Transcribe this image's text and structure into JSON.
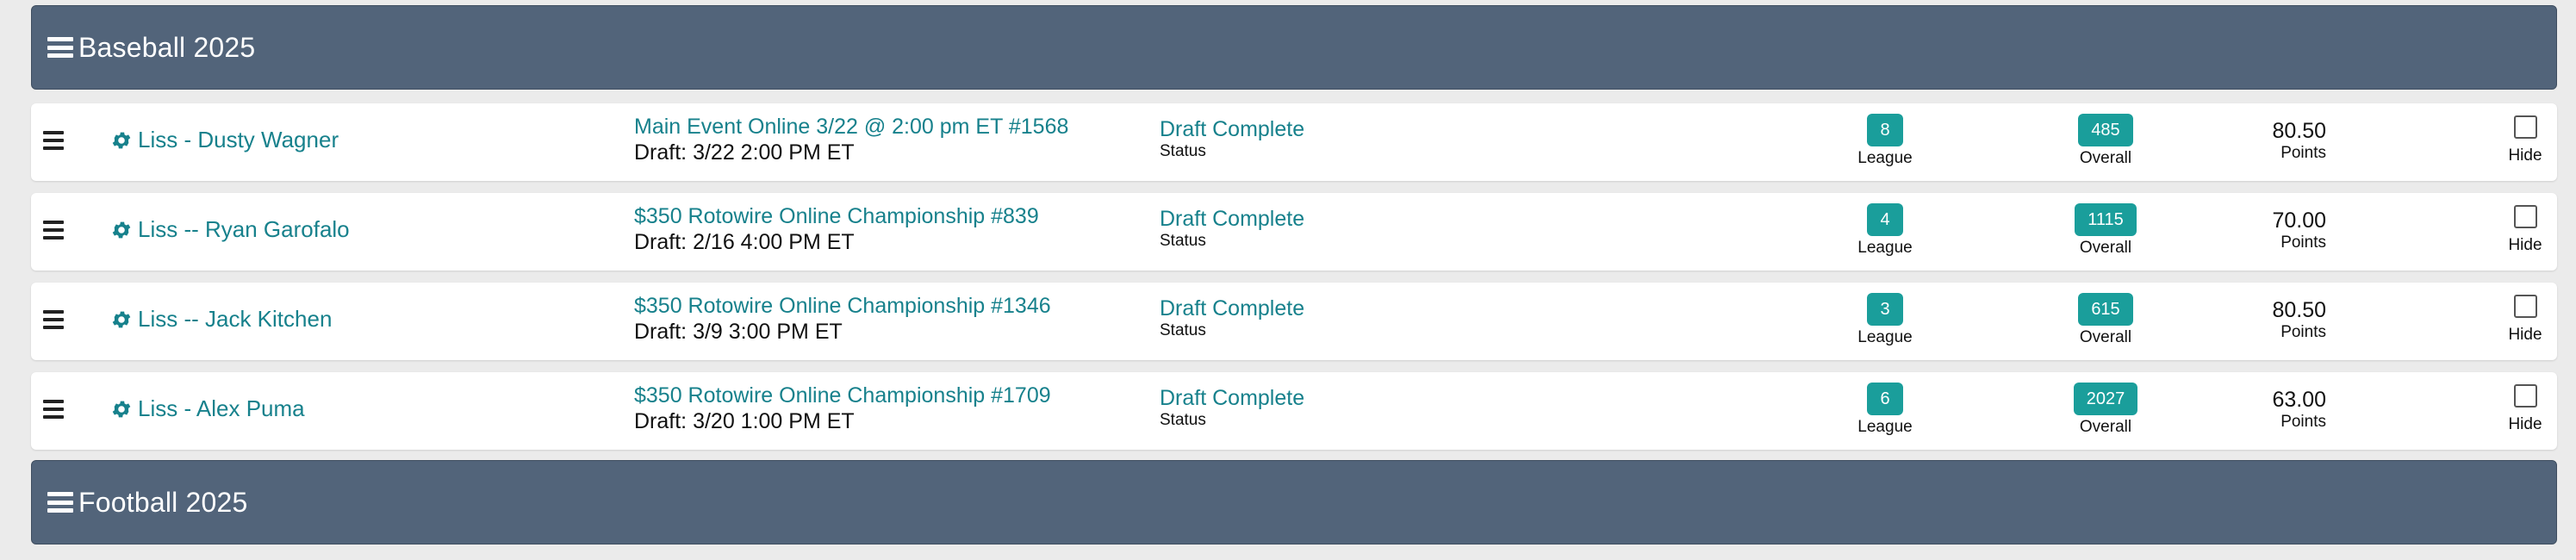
{
  "sections": [
    {
      "title": "Baseball 2025"
    },
    {
      "title": "Football 2025"
    }
  ],
  "entries": [
    {
      "name": "Liss - Dusty Wagner",
      "contest": "Main Event Online 3/22 @ 2:00 pm ET #1568",
      "draft_time": "Draft: 3/22 2:00 PM ET",
      "status": "Draft Complete",
      "status_label": "Status",
      "league_rank": "8",
      "league_label": "League",
      "overall_rank": "485",
      "overall_label": "Overall",
      "points": "80.50",
      "points_label": "Points",
      "hide_label": "Hide"
    },
    {
      "name": "Liss -- Ryan Garofalo",
      "contest": "$350 Rotowire Online Championship #839",
      "draft_time": "Draft: 2/16 4:00 PM ET",
      "status": "Draft Complete",
      "status_label": "Status",
      "league_rank": "4",
      "league_label": "League",
      "overall_rank": "1115",
      "overall_label": "Overall",
      "points": "70.00",
      "points_label": "Points",
      "hide_label": "Hide"
    },
    {
      "name": "Liss -- Jack Kitchen",
      "contest": "$350 Rotowire Online Championship #1346",
      "draft_time": "Draft: 3/9 3:00 PM ET",
      "status": "Draft Complete",
      "status_label": "Status",
      "league_rank": "3",
      "league_label": "League",
      "overall_rank": "615",
      "overall_label": "Overall",
      "points": "80.50",
      "points_label": "Points",
      "hide_label": "Hide"
    },
    {
      "name": "Liss - Alex Puma",
      "contest": "$350 Rotowire Online Championship #1709",
      "draft_time": "Draft: 3/20 1:00 PM ET",
      "status": "Draft Complete",
      "status_label": "Status",
      "league_rank": "6",
      "league_label": "League",
      "overall_rank": "2027",
      "overall_label": "Overall",
      "points": "63.00",
      "points_label": "Points",
      "hide_label": "Hide"
    }
  ],
  "icons": {
    "section_toggle": "menu-icon",
    "row_handle": "drag-handle-icon",
    "entry_settings": "gear-icon"
  },
  "colors": {
    "header_bg": "#52647a",
    "link": "#17818c",
    "badge": "#1a9e9b",
    "page_bg": "#ebebeb"
  }
}
